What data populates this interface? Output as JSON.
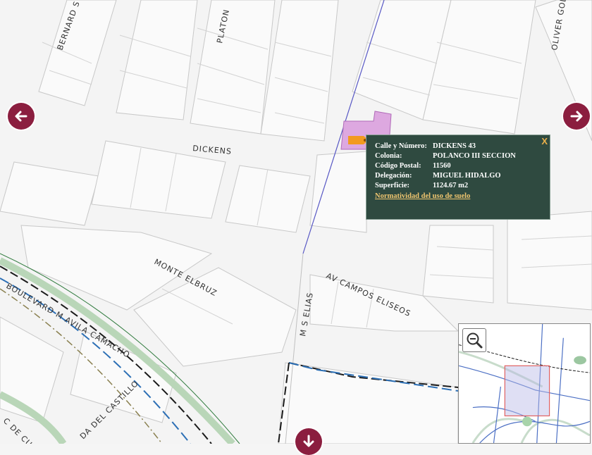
{
  "streets": {
    "bernard": "BERNARD S",
    "platon": "PLATON",
    "oliver": "OLIVER GOL",
    "dickens": "DICKENS",
    "monte_elbruz": "MONTE ELBRUZ",
    "campos_eliseos": "AV CAMPOS ELISEOS",
    "m_s_elias": "M S ELIAS",
    "boulevard": "BOULEVARD M AVILA CAMACHO",
    "castillo": "DA DEL CASTILLO",
    "cue": "C DE CUE"
  },
  "popup": {
    "close_label": "X",
    "rows": [
      {
        "key": "Calle y Número:",
        "value": "DICKENS 43"
      },
      {
        "key": "Colonia:",
        "value": "POLANCO III SECCION"
      },
      {
        "key": "Código Postal:",
        "value": "11560"
      },
      {
        "key": "Delegación:",
        "value": "MIGUEL HIDALGO"
      },
      {
        "key": "Superficie:",
        "value": "1124.67 m2"
      }
    ],
    "link_label": "Normatividad del uso de suelo"
  },
  "icons": {
    "left": "arrow-left-icon",
    "right": "arrow-right-icon",
    "down": "arrow-down-icon",
    "zoom": "zoom-out-icon"
  },
  "colors": {
    "nav": "#8b1e3f",
    "popup_bg": "#2f4a40",
    "parcel": "#dda8e0",
    "marker": "#f29a1f",
    "link": "#f0c56f"
  }
}
